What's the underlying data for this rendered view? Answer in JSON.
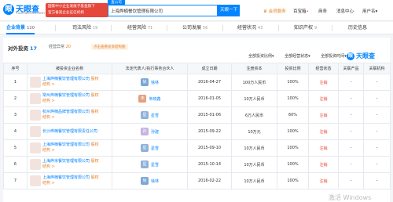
{
  "header": {
    "logo_text": "天眼查",
    "logo_domain": "TianYanCha.com",
    "promo_line1": "国家中小企业发展子基金旗下",
    "promo_line2": "官方备案企业征信机构",
    "search_tag": "查公司",
    "search_value": "上海烨楠餐饮管理有限公司",
    "search_button": "天眼一下",
    "nav": [
      "会员服务",
      "百宝箱",
      "商务",
      "消息中心",
      "用户名"
    ],
    "nav_vip_icon": "crown-icon"
  },
  "tabs": [
    {
      "label": "企业背景",
      "count": "120"
    },
    {
      "label": "司法风险",
      "count": "19"
    },
    {
      "label": "经营风险",
      "count": "71"
    },
    {
      "label": "公司发展",
      "count": "56"
    },
    {
      "label": "经营状况",
      "count": "43"
    },
    {
      "label": "知识产权",
      "count": "9"
    },
    {
      "label": "历史信息",
      "count": ""
    }
  ],
  "section": {
    "title": "对外投资",
    "count": "17",
    "sub_title": "经营异常",
    "sub_count": "20",
    "tag": "点击查看投资结构图",
    "filters": [
      "全部投资比例",
      "全部经营状态",
      "全部投资时间"
    ],
    "watermark": "天眼查"
  },
  "table": {
    "headers": [
      "序号",
      "被投资企业名称",
      "法定代表人/执行事务合伙人",
      "成立日期",
      "注册资本",
      "投资比例",
      "经营状态",
      "关联产品",
      "关联机构"
    ],
    "rows": [
      {
        "no": "1",
        "company": "上海烨楠餐饮管理有限公司",
        "equity": "股权结构 >",
        "person_initial": "徐",
        "person": "徐林",
        "date": "2016-04-27",
        "capital": "100万人民币",
        "ratio": "100%",
        "status": "注销",
        "product": "-",
        "org": "-",
        "color": "#7aa7d6"
      },
      {
        "no": "2",
        "company": "常州烨楠餐饮管理有限公司",
        "equity": "股权结构 >",
        "person_initial": "朱",
        "person": "朱晓鑫",
        "date": "2016-01-05",
        "capital": "10万人民币",
        "ratio": "100%",
        "status": "注销",
        "product": "-",
        "org": "-",
        "color": "#e3a07e"
      },
      {
        "no": "3",
        "company": "杭州烨楠品牌管理有限公司",
        "equity": "股权结构 >",
        "person_initial": "星",
        "person": "星雪",
        "date": "2015-01-06",
        "capital": "6万人民币",
        "ratio": "60%",
        "status": "注销",
        "product": "-",
        "org": "-",
        "color": "#8fb1da"
      },
      {
        "no": "4",
        "company": "长沙烨楠餐饮管理有限责任公司",
        "equity": "",
        "person_initial": "孙",
        "person": "孙建",
        "date": "2015-09-22",
        "capital": "10万元",
        "ratio": "100%",
        "status": "注销",
        "product": "-",
        "org": "-",
        "color": "#c5b3e0"
      },
      {
        "no": "5",
        "company": "上海烨楠餐饮管理有限公司",
        "equity": "股权结构 >",
        "person_initial": "星",
        "person": "星雪",
        "date": "2015-09-10",
        "capital": "10万人民币",
        "ratio": "100%",
        "status": "注销",
        "product": "-",
        "org": "-",
        "color": "#8fb1da"
      },
      {
        "no": "6",
        "company": "上海烨米餐饮管理有限公司",
        "equity": "股权结构 >",
        "person_initial": "星",
        "person": "星雪",
        "date": "2015-10-14",
        "capital": "10万人民币",
        "ratio": "100%",
        "status": "注销",
        "product": "-",
        "org": "-",
        "color": "#8fb1da"
      },
      {
        "no": "7",
        "company": "上海烨楠餐饮管理有限公司",
        "equity": "股权结构 >",
        "person_initial": "徐",
        "person": "徐林",
        "date": "2016-02-22",
        "capital": "10万人民币",
        "ratio": "100%",
        "status": "注销",
        "product": "-",
        "org": "-",
        "color": "#7aa7d6"
      }
    ]
  },
  "windows_watermark": "激活 Windows"
}
